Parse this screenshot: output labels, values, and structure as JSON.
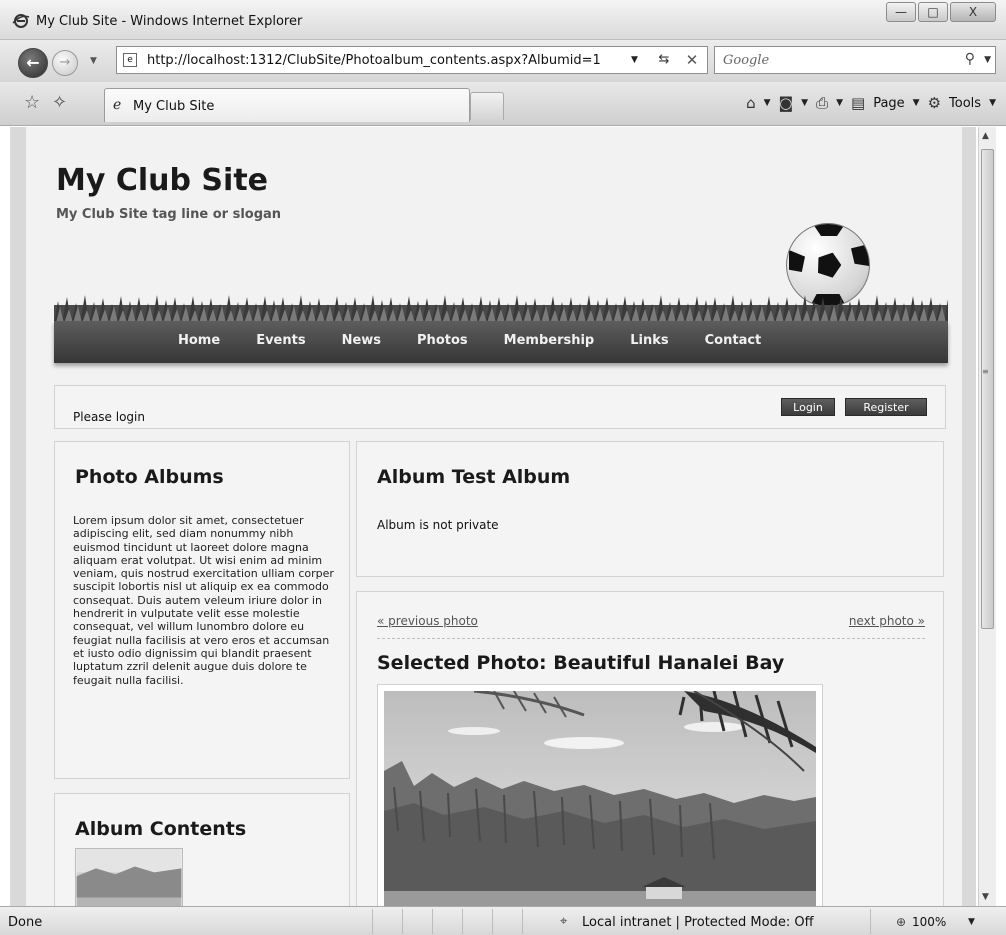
{
  "window": {
    "title": "My Club Site - Windows Internet Explorer",
    "controls": {
      "minimize": "—",
      "maximize": "□",
      "close": "X"
    }
  },
  "addressbar": {
    "url": "http://localhost:1312/ClubSite/Photoalbum_contents.aspx?Albumid=1",
    "search_placeholder": "Google"
  },
  "tabs": {
    "active_label": "My Club Site"
  },
  "command_bar": {
    "page_label": "Page",
    "tools_label": "Tools"
  },
  "site": {
    "title": "My Club Site",
    "tagline": "My Club Site tag line or slogan",
    "nav": [
      "Home",
      "Events",
      "News",
      "Photos",
      "Membership",
      "Links",
      "Contact"
    ]
  },
  "login": {
    "message": "Please login",
    "login_label": "Login",
    "register_label": "Register"
  },
  "sidebar": {
    "albums_heading": "Photo Albums",
    "albums_text": "Lorem ipsum dolor sit amet, consectetuer adipiscing elit, sed diam nonummy nibh euismod tincidunt ut laoreet dolore magna aliquam erat volutpat. Ut wisi enim ad minim veniam, quis nostrud exercitation ulliam corper suscipit lobortis nisl ut aliquip ex ea commodo consequat. Duis autem veleum iriure dolor in hendrerit in vulputate velit esse molestie consequat, vel willum lunombro dolore eu feugiat nulla facilisis at vero eros et accumsan et iusto odio dignissim qui blandit praesent luptatum zzril delenit augue duis dolore te feugait nulla facilisi.",
    "contents_heading": "Album Contents"
  },
  "album": {
    "heading": "Album Test Album",
    "privacy": "Album is not private"
  },
  "photo": {
    "prev_label": "« previous photo",
    "next_label": "next photo »",
    "heading": "Selected Photo: Beautiful Hanalei Bay"
  },
  "status": {
    "text": "Done",
    "zone": "Local intranet | Protected Mode: Off",
    "zoom": "100%"
  },
  "icons": {
    "ie": "ie-logo-icon",
    "back": "back-arrow-icon",
    "forward": "forward-arrow-icon",
    "refresh": "refresh-icon",
    "stop": "stop-icon",
    "search": "search-icon",
    "favorites": "favorites-star-icon",
    "home": "home-icon",
    "feeds": "feeds-icon",
    "print": "print-icon"
  }
}
